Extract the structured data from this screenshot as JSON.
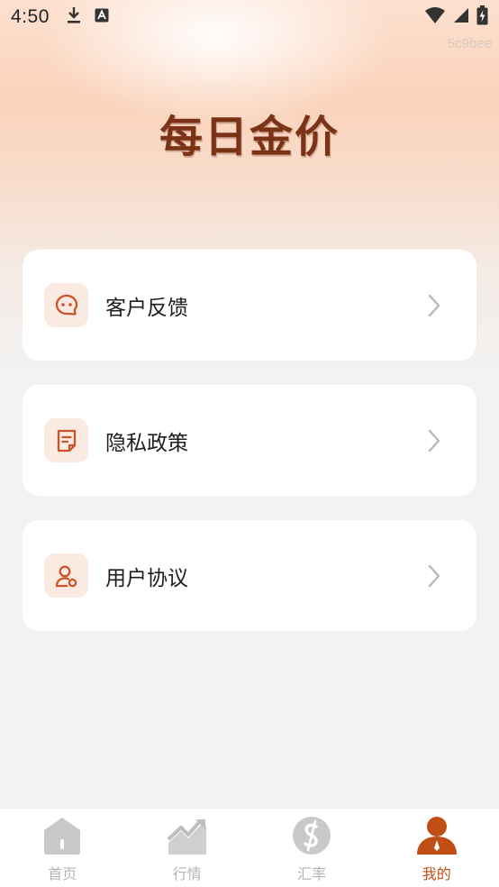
{
  "status_bar": {
    "time": "4:50",
    "icons": [
      "download-icon",
      "accessibility-a-icon"
    ],
    "right_icons": [
      "wifi-icon",
      "signal-icon",
      "battery-charging-icon"
    ]
  },
  "build_tag": "5c9bee",
  "hero": {
    "title": "每日金价"
  },
  "menu": {
    "items": [
      {
        "label": "客户反馈",
        "icon": "feedback-chat-icon"
      },
      {
        "label": "隐私政策",
        "icon": "document-icon"
      },
      {
        "label": "用户协议",
        "icon": "user-agreement-icon"
      }
    ]
  },
  "tabbar": {
    "tabs": [
      {
        "label": "首页",
        "icon": "home-icon",
        "active": false
      },
      {
        "label": "行情",
        "icon": "market-trend-icon",
        "active": false
      },
      {
        "label": "汇率",
        "icon": "exchange-rate-icon",
        "active": false
      },
      {
        "label": "我的",
        "icon": "profile-icon",
        "active": true
      }
    ]
  },
  "colors": {
    "accent": "#c04f16",
    "hero_title": "#7a3316",
    "icon_bg": "#fbeae1",
    "inactive_tab": "#b4b4b4",
    "page_bg": "#f2f2f2"
  }
}
